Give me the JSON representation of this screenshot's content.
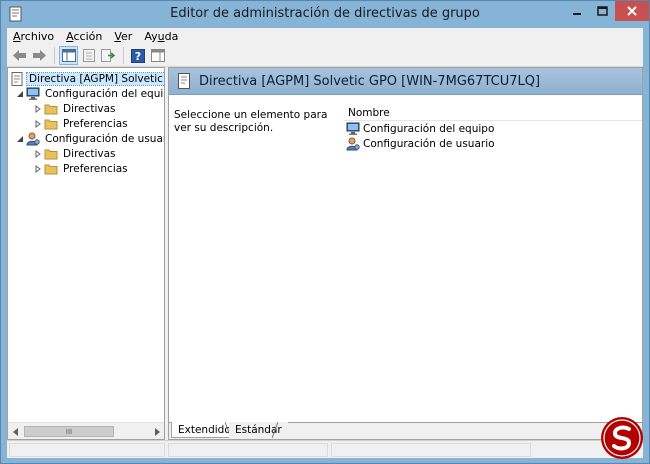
{
  "window": {
    "title": "Editor de administración de directivas de grupo"
  },
  "menu": {
    "items": [
      {
        "label_pre": "",
        "label_u": "A",
        "label_post": "rchivo"
      },
      {
        "label_pre": "",
        "label_u": "A",
        "label_post": "cción"
      },
      {
        "label_pre": "",
        "label_u": "V",
        "label_post": "er"
      },
      {
        "label_pre": "Ay",
        "label_u": "u",
        "label_post": "da"
      }
    ]
  },
  "toolbar": {
    "buttons": [
      "back-arrow-icon",
      "forward-arrow-icon",
      "show-hide-tree-icon",
      "properties-icon",
      "export-list-icon",
      "help-icon",
      "action-pane-icon"
    ]
  },
  "tree": {
    "root": "Directiva [AGPM] Solvetic GPO",
    "computer_config": "Configuración del equipo",
    "user_config": "Configuración de usuario",
    "directivas": "Directivas",
    "preferencias": "Preferencias",
    "scroll_grip": "III"
  },
  "details": {
    "header_title": "Directiva [AGPM] Solvetic GPO [WIN-7MG67TCU7LQ]",
    "description": "Seleccione un elemento para ver su descripción.",
    "column_name": "Nombre",
    "rows": [
      "Configuración del equipo",
      "Configuración de usuario"
    ]
  },
  "tabs": {
    "extended": "Extendido",
    "standard": "Estándar"
  },
  "colors": {
    "title_bar": "#86b4d7",
    "close_button": "#c75050",
    "header_band": "#98b8d6",
    "selection": "#cce8ff",
    "logo": "#b30000"
  }
}
